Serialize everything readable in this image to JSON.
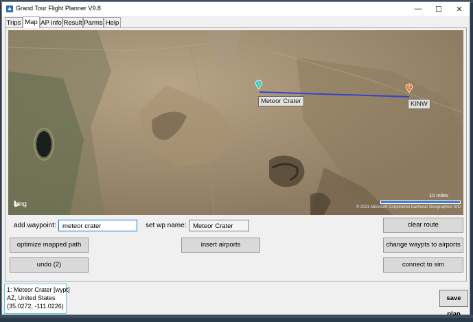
{
  "window": {
    "title": "Grand Tour Flight Planner V9.8",
    "controls": {
      "minimize": "—",
      "maximize": "☐",
      "close": "✕"
    }
  },
  "tabs": [
    {
      "label": "Trips",
      "active": false
    },
    {
      "label": "Map",
      "active": true
    },
    {
      "label": "AP info",
      "active": false
    },
    {
      "label": "Result",
      "active": false
    },
    {
      "label": "Parms",
      "active": false
    },
    {
      "label": "Help",
      "active": false
    }
  ],
  "map": {
    "waypoints": [
      {
        "number": "1",
        "label": "Meteor Crater",
        "color": "#3cc7c0"
      },
      {
        "number": "2",
        "label": "KINW",
        "color": "#e07a3c"
      }
    ],
    "route_color": "#3344cc",
    "provider": "bing",
    "copyright": "© 2021 Microsoft Corporation  Earthstar Geographics  SIO",
    "scale": "10 miles"
  },
  "form": {
    "add_waypoint_label": "add waypoint:",
    "add_waypoint_value": "meteor crater",
    "set_wp_name_label": "set wp name:",
    "set_wp_name_value": "Meteor Crater"
  },
  "buttons": {
    "clear_route": "clear route",
    "optimize": "optimize mapped path",
    "insert_airports": "insert airports",
    "change_waypts": "change waypts to airports",
    "undo": "undo (2)",
    "connect": "connect to sim",
    "save_plan": "save plan"
  },
  "info": {
    "line1": "1: Meteor Crater [wypt]",
    "line2": "AZ, United States",
    "line3": "(35.0272, -111.0226)"
  }
}
